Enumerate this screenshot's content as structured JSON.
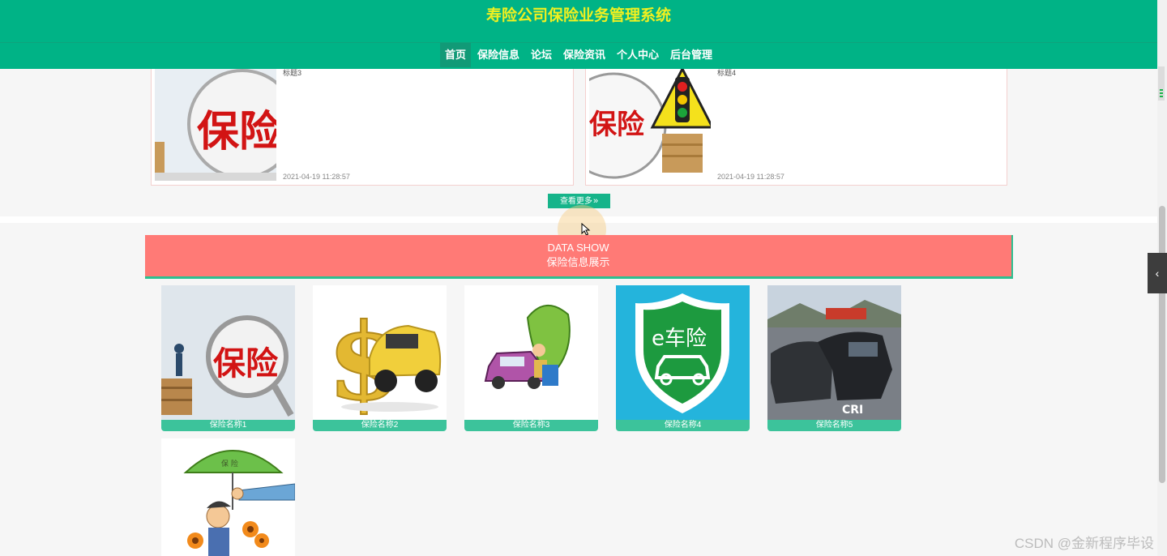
{
  "header": {
    "title": "寿险公司保险业务管理系统",
    "nav": [
      {
        "label": "首页"
      },
      {
        "label": "保险信息"
      },
      {
        "label": "论坛"
      },
      {
        "label": "保险资讯"
      },
      {
        "label": "个人中心"
      },
      {
        "label": "后台管理"
      }
    ],
    "active_index": 0
  },
  "news": [
    {
      "title": "标题3",
      "date": "2021-04-19 11:28:57",
      "image": "insurance-magnifier-coins"
    },
    {
      "title": "标题4",
      "date": "2021-04-19 11:28:57",
      "image": "insurance-traffic-light"
    }
  ],
  "more_button": {
    "label": "查看更多",
    "icon": "double-chevron-right-icon"
  },
  "data_show": {
    "title_en": "DATA SHOW",
    "title_cn": "保险信息展示"
  },
  "products": [
    {
      "name": "保险名称1",
      "image": "insurance-magnifier"
    },
    {
      "name": "保险名称2",
      "image": "dollar-car-crash"
    },
    {
      "name": "保险名称3",
      "image": "umbrella-car-cartoon"
    },
    {
      "name": "保险名称4",
      "image": "e-car-insurance-shield"
    },
    {
      "name": "保险名称5",
      "image": "car-accident-photo"
    },
    {
      "name": "",
      "image": "umbrella-protect-cartoon"
    }
  ],
  "product_4_logo": "e车险",
  "umbrella_text": "保 险",
  "colors": {
    "primary": "#00b386",
    "title": "#f0f020",
    "banner": "#ff7a76",
    "product_label": "#3cc39b"
  },
  "watermark": "CSDN @金新程序毕设"
}
